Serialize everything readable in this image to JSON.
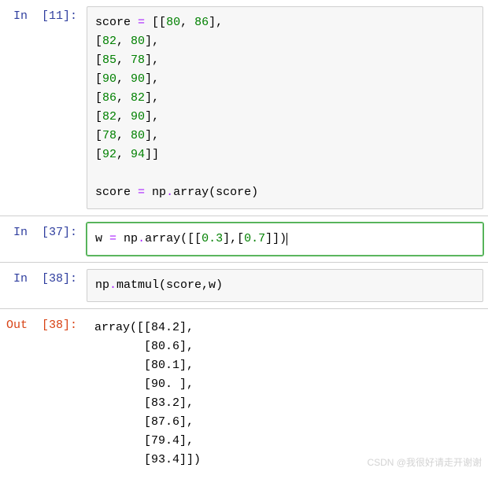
{
  "cells": [
    {
      "prompt_kind": "In",
      "exec_count": "11",
      "type": "code",
      "selected": false,
      "tokens": [
        [
          "ident",
          "score"
        ],
        [
          "punct",
          " "
        ],
        [
          "op",
          "="
        ],
        [
          "punct",
          " [["
        ],
        [
          "num",
          "80"
        ],
        [
          "punct",
          ", "
        ],
        [
          "num",
          "86"
        ],
        [
          "punct",
          "],"
        ],
        [
          "nl",
          ""
        ],
        [
          "punct",
          "["
        ],
        [
          "num",
          "82"
        ],
        [
          "punct",
          ", "
        ],
        [
          "num",
          "80"
        ],
        [
          "punct",
          "],"
        ],
        [
          "nl",
          ""
        ],
        [
          "punct",
          "["
        ],
        [
          "num",
          "85"
        ],
        [
          "punct",
          ", "
        ],
        [
          "num",
          "78"
        ],
        [
          "punct",
          "],"
        ],
        [
          "nl",
          ""
        ],
        [
          "punct",
          "["
        ],
        [
          "num",
          "90"
        ],
        [
          "punct",
          ", "
        ],
        [
          "num",
          "90"
        ],
        [
          "punct",
          "],"
        ],
        [
          "nl",
          ""
        ],
        [
          "punct",
          "["
        ],
        [
          "num",
          "86"
        ],
        [
          "punct",
          ", "
        ],
        [
          "num",
          "82"
        ],
        [
          "punct",
          "],"
        ],
        [
          "nl",
          ""
        ],
        [
          "punct",
          "["
        ],
        [
          "num",
          "82"
        ],
        [
          "punct",
          ", "
        ],
        [
          "num",
          "90"
        ],
        [
          "punct",
          "],"
        ],
        [
          "nl",
          ""
        ],
        [
          "punct",
          "["
        ],
        [
          "num",
          "78"
        ],
        [
          "punct",
          ", "
        ],
        [
          "num",
          "80"
        ],
        [
          "punct",
          "],"
        ],
        [
          "nl",
          ""
        ],
        [
          "punct",
          "["
        ],
        [
          "num",
          "92"
        ],
        [
          "punct",
          ", "
        ],
        [
          "num",
          "94"
        ],
        [
          "punct",
          "]]"
        ],
        [
          "nl",
          ""
        ],
        [
          "nl",
          ""
        ],
        [
          "ident",
          "score"
        ],
        [
          "punct",
          " "
        ],
        [
          "op",
          "="
        ],
        [
          "punct",
          " np"
        ],
        [
          "op",
          "."
        ],
        [
          "punct",
          "array(score)"
        ]
      ]
    },
    {
      "prompt_kind": "In",
      "exec_count": "37",
      "type": "code",
      "selected": true,
      "tokens": [
        [
          "ident",
          "w"
        ],
        [
          "punct",
          " "
        ],
        [
          "op",
          "="
        ],
        [
          "punct",
          " np"
        ],
        [
          "op",
          "."
        ],
        [
          "punct",
          "array([["
        ],
        [
          "num",
          "0.3"
        ],
        [
          "punct",
          "],["
        ],
        [
          "num",
          "0.7"
        ],
        [
          "punct",
          "]])"
        ],
        [
          "caret",
          ""
        ]
      ]
    },
    {
      "prompt_kind": "In",
      "exec_count": "38",
      "type": "code",
      "selected": false,
      "tokens": [
        [
          "ident",
          "np"
        ],
        [
          "op",
          "."
        ],
        [
          "punct",
          "matmul(score,w)"
        ]
      ]
    },
    {
      "prompt_kind": "Out",
      "exec_count": "38",
      "type": "output",
      "text": "array([[84.2],\n       [80.6],\n       [80.1],\n       [90. ],\n       [83.2],\n       [87.6],\n       [79.4],\n       [93.4]])"
    }
  ],
  "watermark": "CSDN @我很好请走开谢谢",
  "colors": {
    "in_prompt": "#303F9F",
    "out_prompt": "#D84315",
    "number_literal": "#008000",
    "operator": "#AA22FF",
    "selected_border": "#4caf50"
  }
}
